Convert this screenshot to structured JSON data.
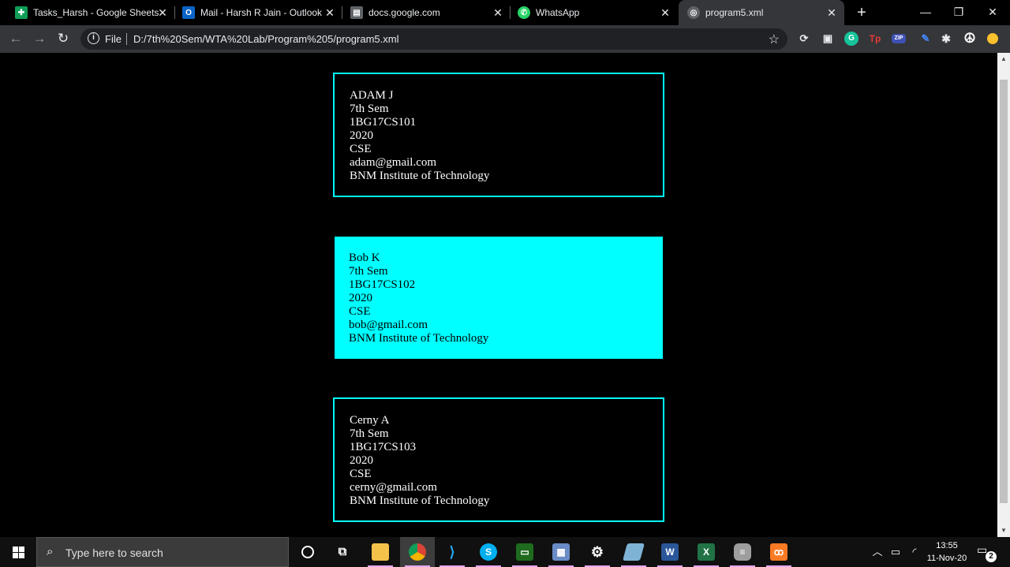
{
  "browser": {
    "tabs": [
      {
        "title": "Tasks_Harsh - Google Sheets",
        "icon": "google-sheets-icon",
        "color": "#0f9d58"
      },
      {
        "title": "Mail - Harsh R Jain - Outlook",
        "icon": "outlook-icon",
        "color": "#0a64c8"
      },
      {
        "title": "docs.google.com",
        "icon": "google-docs-icon",
        "color": "#9aa0a6"
      },
      {
        "title": "WhatsApp",
        "icon": "whatsapp-icon",
        "color": "#25d366"
      },
      {
        "title": "program5.xml",
        "icon": "globe-icon",
        "color": "#9aa0a6"
      }
    ],
    "address": {
      "scheme_label": "File",
      "url": "D:/7th%20Sem/WTA%20Lab/Program%205/program5.xml"
    }
  },
  "page": {
    "students": [
      {
        "name": "ADAM J",
        "sem": "7th Sem",
        "usn": "1BG17CS101",
        "year": "2020",
        "branch": "CSE",
        "email": "adam@gmail.com",
        "college": "BNM Institute of Technology",
        "style": "outlined"
      },
      {
        "name": "Bob K",
        "sem": "7th Sem",
        "usn": "1BG17CS102",
        "year": "2020",
        "branch": "CSE",
        "email": "bob@gmail.com",
        "college": "BNM Institute of Technology",
        "style": "filled"
      },
      {
        "name": "Cerny A",
        "sem": "7th Sem",
        "usn": "1BG17CS103",
        "year": "2020",
        "branch": "CSE",
        "email": "cerny@gmail.com",
        "college": "BNM Institute of Technology",
        "style": "outlined"
      }
    ],
    "accent_color": "#00ffff"
  },
  "taskbar": {
    "search_placeholder": "Type here to search",
    "time": "13:55",
    "date": "11-Nov-20",
    "notification_count": "2"
  }
}
